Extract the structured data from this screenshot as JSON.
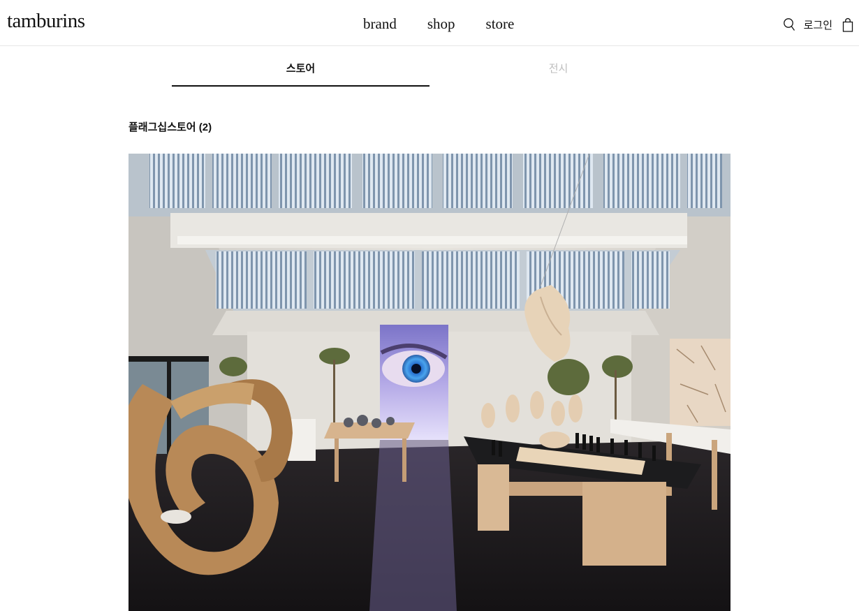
{
  "header": {
    "logo": "tamburins",
    "nav": [
      {
        "label": "brand"
      },
      {
        "label": "shop"
      },
      {
        "label": "store"
      }
    ],
    "search_icon": "search-icon",
    "login_label": "로그인",
    "bag_icon": "shopping-bag-icon"
  },
  "tabs": [
    {
      "label": "스토어",
      "active": true
    },
    {
      "label": "전시",
      "active": false
    }
  ],
  "section": {
    "title": "플래그십스토어 (2)"
  },
  "colors": {
    "active_tab_underline": "#111111",
    "inactive_tab_text": "#bdbdbd",
    "header_border": "#e6e6e6"
  }
}
